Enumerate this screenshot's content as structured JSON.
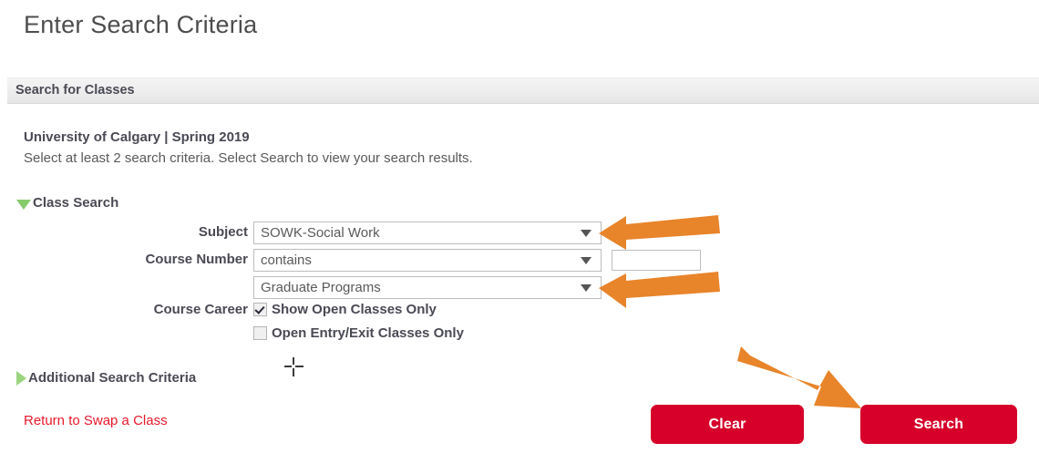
{
  "page": {
    "title": "Enter Search Criteria"
  },
  "section": {
    "header_label": "Search for Classes",
    "institution_term": "University of Calgary | Spring 2019",
    "instructions": "Select at least 2 search criteria. Select Search to view your search results."
  },
  "groups": {
    "class_search": {
      "label": "Class Search",
      "expanded": true,
      "toggle_icon": "triangle-down-icon"
    },
    "additional_search_criteria": {
      "label": "Additional Search Criteria",
      "expanded": false,
      "toggle_icon": "triangle-right-icon"
    }
  },
  "form": {
    "subject": {
      "label": "Subject",
      "value": "SOWK-Social Work",
      "dropdown_icon": "chevron-down-icon"
    },
    "course_number": {
      "label": "Course Number",
      "operator_value": "contains",
      "operator_dropdown_icon": "chevron-down-icon",
      "text_value": "",
      "text_placeholder": ""
    },
    "course_career": {
      "label": "Course Career",
      "value": "Graduate Programs",
      "dropdown_icon": "chevron-down-icon"
    },
    "checkboxes": [
      {
        "label": "Show Open Classes Only",
        "checked": true
      },
      {
        "label": "Open Entry/Exit Classes Only",
        "checked": false
      }
    ]
  },
  "links": {
    "return_to_swap": "Return to Swap a Class"
  },
  "buttons": {
    "clear": "Clear",
    "search": "Search"
  },
  "annotations": {
    "arrow_color": "#e8842a",
    "arrows": [
      {
        "name": "arrow-pointing-to-subject-dropdown",
        "direction": "left"
      },
      {
        "name": "arrow-pointing-to-course-career-dropdown",
        "direction": "left"
      },
      {
        "name": "arrow-pointing-to-search-button",
        "direction": "down-right"
      }
    ],
    "cursor": "crosshair-cursor"
  },
  "colors": {
    "button_red": "#d6002a",
    "link_red": "#e8192c",
    "triangle_green": "#86cb6b",
    "header_band": "#eeeeee",
    "label_text": "#4a4a55"
  }
}
